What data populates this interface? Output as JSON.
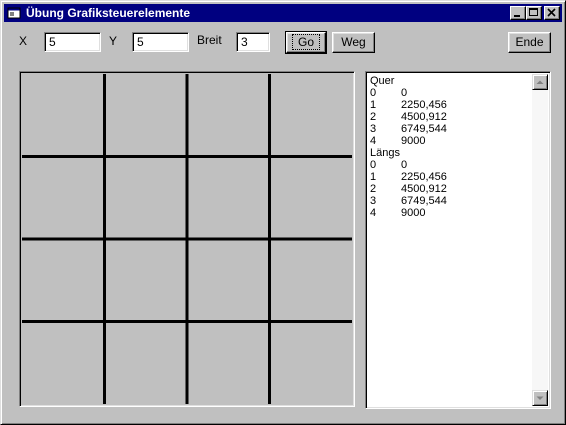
{
  "window": {
    "title": "Übung Grafiksteuerelemente",
    "app_icon": "vb-form-icon"
  },
  "title_buttons": [
    "minimize-icon",
    "maximize-icon",
    "close-icon"
  ],
  "toolbar": {
    "x_label": "X",
    "x_value": "5",
    "y_label": "Y",
    "y_value": "5",
    "breit_label": "Breit",
    "breit_value": "3",
    "go_label": "Go",
    "weg_label": "Weg",
    "ende_label": "Ende"
  },
  "grid": {
    "rows": 4,
    "cols": 4,
    "line_color": "#000000",
    "background": "#c0c0c0"
  },
  "list": {
    "items": [
      {
        "c1": "Quer",
        "c2": ""
      },
      {
        "c1": "0",
        "c2": "0"
      },
      {
        "c1": "1",
        "c2": "2250,456"
      },
      {
        "c1": "2",
        "c2": "4500,912"
      },
      {
        "c1": "3",
        "c2": "6749,544"
      },
      {
        "c1": "4",
        "c2": "9000"
      },
      {
        "c1": "Längs",
        "c2": ""
      },
      {
        "c1": "0",
        "c2": "0"
      },
      {
        "c1": "1",
        "c2": "2250,456"
      },
      {
        "c1": "2",
        "c2": "4500,912"
      },
      {
        "c1": "3",
        "c2": "6749,544"
      },
      {
        "c1": "4",
        "c2": "9000"
      }
    ]
  },
  "colors": {
    "face": "#c0c0c0",
    "title_bar": "#000080",
    "title_text": "#ffffff"
  }
}
